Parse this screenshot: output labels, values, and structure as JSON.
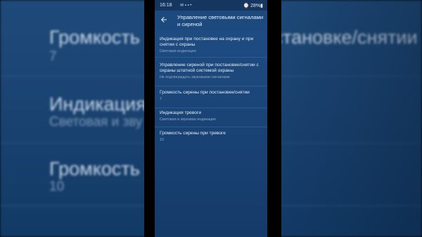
{
  "status": {
    "time": "16:18",
    "icons": "✉ ▪ ▪ •",
    "right": "⌚ 28%▮"
  },
  "header": {
    "title": "Управление световыми сигналами и сиреной"
  },
  "settings": [
    {
      "title": "Индикация при постановке на охрану и при снятии с охраны",
      "value": "Световая индикация"
    },
    {
      "title": "Управление сиреной при постановке/снятии с охраны штатной системой охраны",
      "value": "Не подтверждать звуковыми сигналами"
    },
    {
      "title": "Громкость сирены при постановке/снятии",
      "value": "7"
    },
    {
      "title": "Индикация тревоги",
      "value": "Световая и звуковая индикация"
    },
    {
      "title": "Громкость сирены при тревоге",
      "value": "10"
    }
  ],
  "background": {
    "item1_title": "Громкость сирены при постановке/снятии",
    "item1_value": "7",
    "item2_title": "Индикация т",
    "item2_value": "Световая и зву",
    "item3_title": "Громкость си",
    "item3_title_right": "е",
    "item3_value": "10"
  },
  "colors": {
    "screen_bg": "#1b4679",
    "app_bar": "#1c4a7e",
    "status_bar": "#14365f",
    "primary_text": "#e6eef8",
    "secondary_text": "#8fa9c8"
  }
}
